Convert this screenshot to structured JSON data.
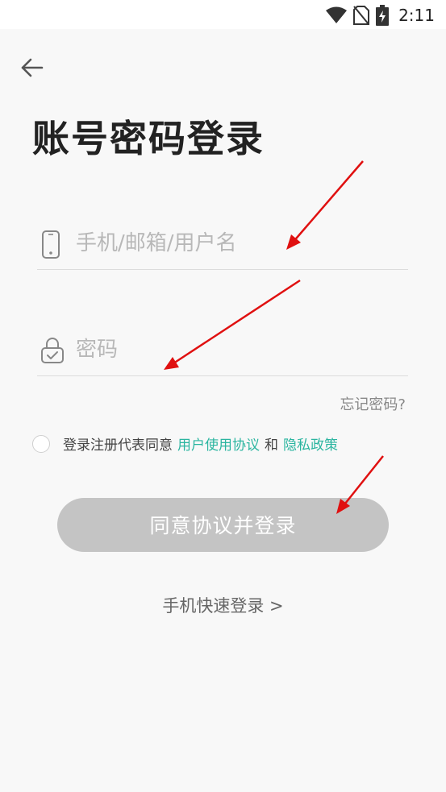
{
  "status_bar": {
    "time": "2:11",
    "icons": [
      "wifi-icon",
      "no-sim-icon",
      "battery-charging-icon"
    ]
  },
  "nav": {
    "back_icon": "back-arrow-icon"
  },
  "page": {
    "title": "账号密码登录"
  },
  "form": {
    "account": {
      "icon": "phone-icon",
      "placeholder": "手机/邮箱/用户名",
      "value": ""
    },
    "password": {
      "icon": "lock-icon",
      "placeholder": "密码",
      "value": ""
    },
    "forgot_label": "忘记密码?"
  },
  "agreement": {
    "checked": false,
    "prefix": "登录注册代表同意",
    "user_agreement": "用户使用协议",
    "conjunction": "和",
    "privacy_policy": "隐私政策"
  },
  "actions": {
    "login_label": "同意协议并登录",
    "phone_login_label": "手机快速登录 >"
  },
  "colors": {
    "background": "#f8f8f8",
    "link": "#2bb5a0",
    "button_disabled": "#c4c4c4",
    "annotation_arrow": "#e01010"
  }
}
